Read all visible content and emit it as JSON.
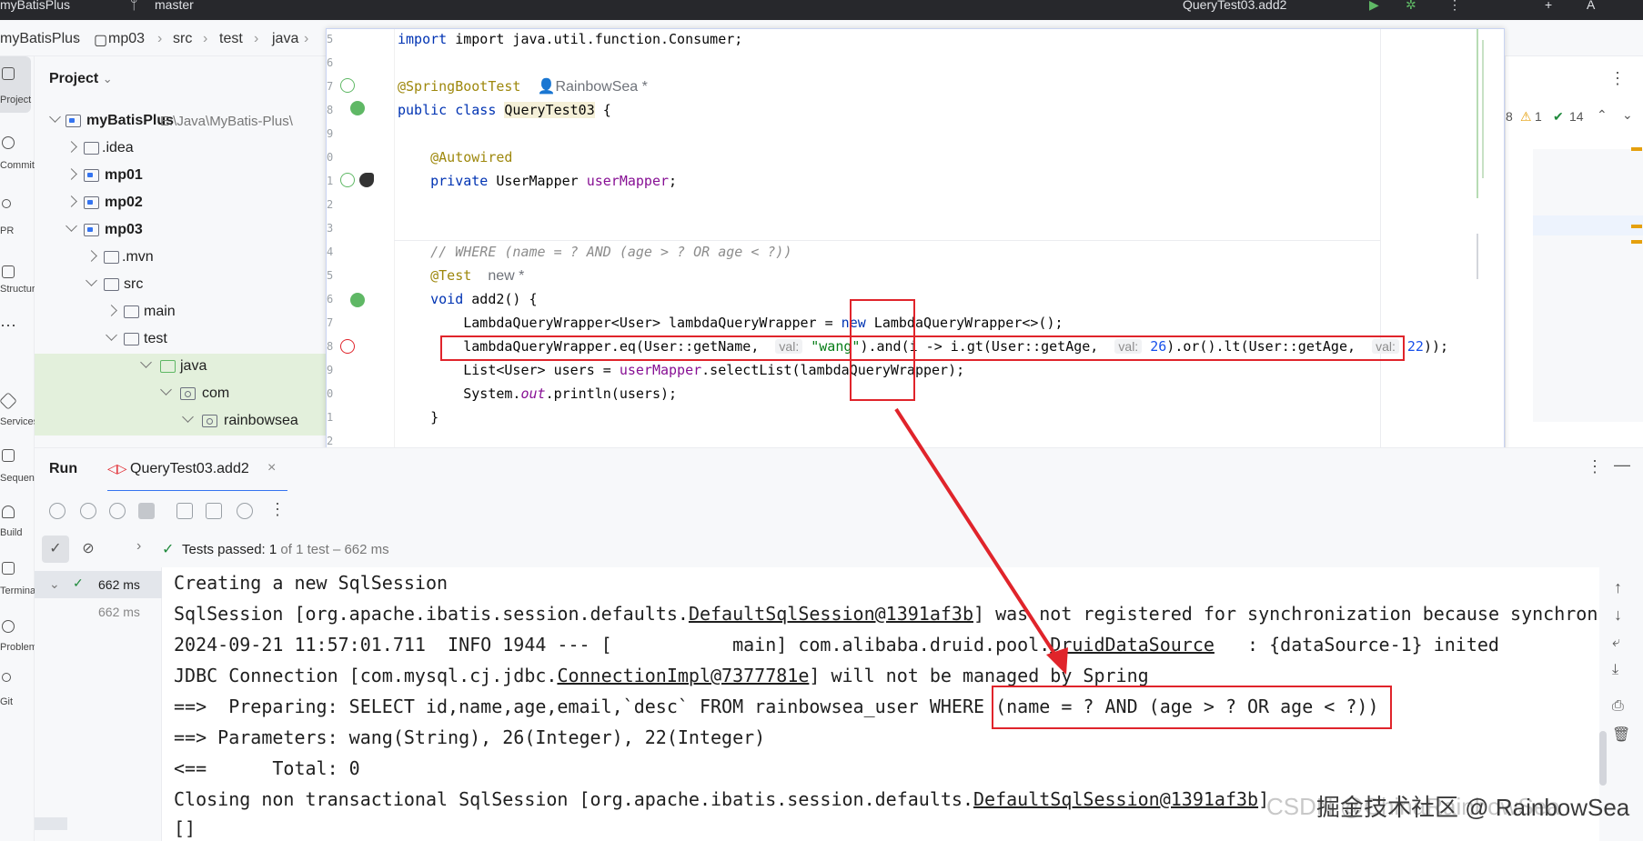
{
  "topbar": {
    "project": "myBatisPlus",
    "branch": "master",
    "run_config": "QueryTest03.add2"
  },
  "breadcrumb": [
    "myBatisPlus",
    "mp03",
    "src",
    "test",
    "java"
  ],
  "stripe": [
    "Project",
    "Commit",
    "PR",
    "Structure",
    "Services",
    "Sequence",
    "Build",
    "Terminal",
    "Problems",
    "Git"
  ],
  "project_panel": {
    "title": "Project",
    "root_name": "myBatisPlus",
    "root_path": "E:\\Java\\MyBatis-Plus\\",
    "items": [
      {
        "name": ".idea"
      },
      {
        "name": "mp01"
      },
      {
        "name": "mp02"
      },
      {
        "name": "mp03"
      },
      {
        "name": ".mvn"
      },
      {
        "name": "src"
      },
      {
        "name": "main"
      },
      {
        "name": "test"
      },
      {
        "name": "java"
      },
      {
        "name": "com"
      },
      {
        "name": "rainbowsea"
      }
    ]
  },
  "editor": {
    "line_numbers": [
      "5",
      "6",
      "7",
      "8",
      "9",
      "0",
      "1",
      "2",
      "3",
      "4",
      "5",
      "6",
      "7",
      "8",
      "9",
      "0",
      "1",
      "2",
      "3"
    ],
    "import_line": "import java.util.function.Consumer;",
    "annotation_springboot": "@SpringBootTest",
    "author_1": "RainbowSea *",
    "class_kw": "public class",
    "class_name": "QueryTest03",
    "brace_open": "{",
    "autowired": "@Autowired",
    "private_kw": "private",
    "field_type": "UserMapper",
    "field_name": "userMapper",
    "semicolon": ";",
    "comment": "// WHERE (name = ? AND (age > ? OR age < ?))",
    "test_annotation": "@Test",
    "author_2": "new *",
    "void_kw": "void",
    "method_sig": "add2() {",
    "line_wrapper_a": "LambdaQueryWrapper<User> lambdaQueryWrapper = ",
    "new_kw": "new",
    "line_wrapper_b": " LambdaQueryWrapper<>();",
    "eq_a": "lambdaQueryWrapper.eq(User::getName,",
    "hint_val": "val:",
    "eq_val": "\"wang\"",
    "eq_b": ").and(i -> i.gt(User::getAge,",
    "gt_val": "26",
    "eq_c": ").or().lt(User::getAge,",
    "lt_val": "22",
    "eq_d": "));",
    "list_a": "List<User> users = ",
    "list_b": ".selectList(lambdaQueryWrapper);",
    "println_a": "System.",
    "println_out": "out",
    "println_b": ".println(users);",
    "brace_close": "}"
  },
  "inspection": {
    "warnings": "1",
    "checks": "14",
    "left": "8"
  },
  "run_panel": {
    "tab_run": "Run",
    "tab_config": "QueryTest03.add2",
    "status_prefix": "Tests passed:",
    "status_count": "1",
    "status_rest": "of 1 test – 662 ms",
    "tree_time_1": "662 ms",
    "tree_time_2": "662 ms"
  },
  "console": {
    "lines": [
      "Creating a new SqlSession",
      "SqlSession [org.apache.ibatis.session.defaults.DefaultSqlSession@1391af3b] was not registered for synchronization because synchroni",
      "2024-09-21 11:57:01.711  INFO 1944 --- [           main] com.alibaba.druid.pool.DruidDataSource   : {dataSource-1} inited",
      "JDBC Connection [com.mysql.cj.jdbc.ConnectionImpl@7377781e] will not be managed by Spring",
      "==>  Preparing: SELECT id,name,age,email,`desc` FROM rainbowsea_user WHERE (name = ? AND (age > ? OR age < ?))",
      "==> Parameters: wang(String), 26(Integer), 22(Integer)",
      "<==      Total: 0",
      "Closing non transactional SqlSession [org.apache.ibatis.session.defaults.DefaultSqlSession@1391af3b]",
      "[]"
    ]
  },
  "watermark": "掘金技术社区 @ RainbowSea",
  "watermark_faded": "CSDN @ChinaRainbowSea",
  "colors": {
    "highlight": "#e0242b",
    "green": "#208a3c",
    "keyword": "#0033b3",
    "annotation": "#9e880d"
  }
}
